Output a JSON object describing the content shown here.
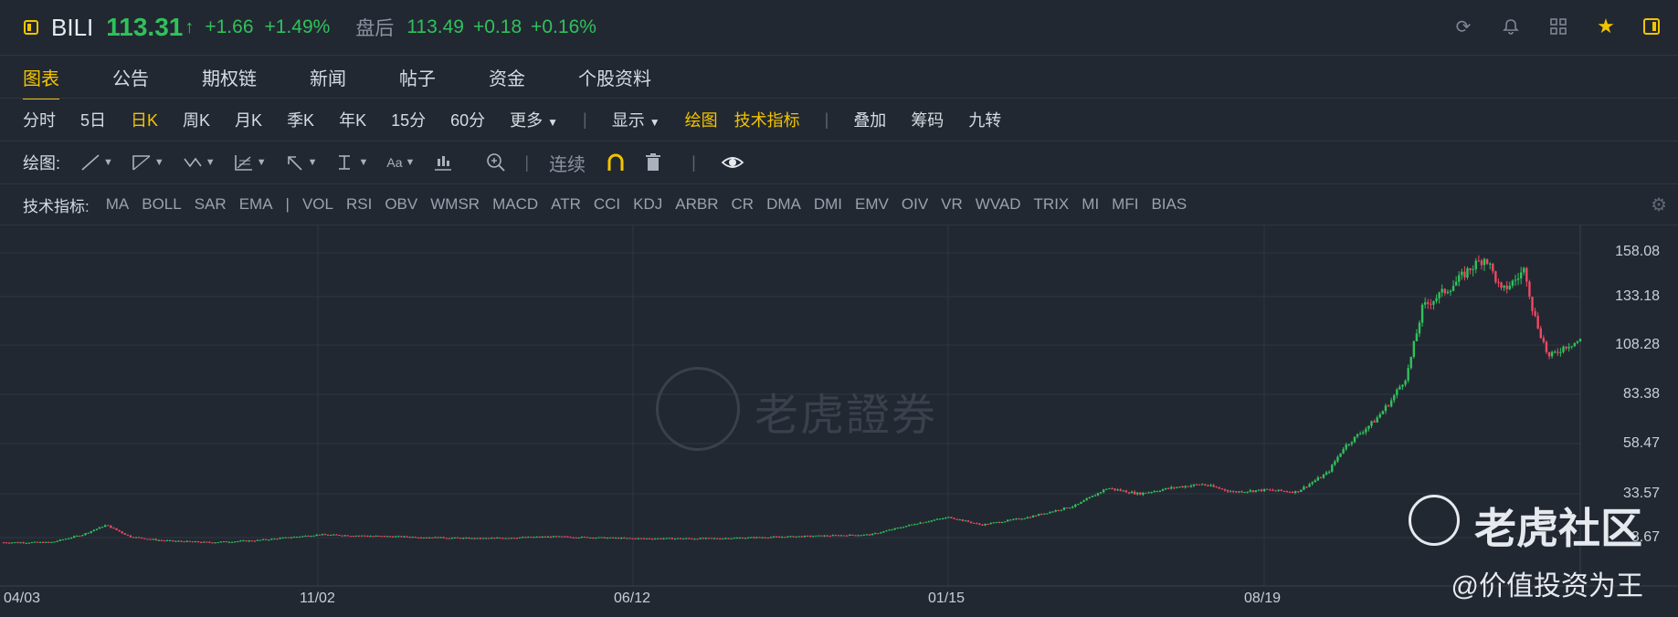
{
  "header": {
    "ticker": "BILI",
    "price": "113.31",
    "arrow": "↑",
    "change": "+1.66",
    "change_pct": "+1.49%",
    "after_hours_label": "盘后",
    "after_hours_price": "113.49",
    "after_hours_change": "+0.18",
    "after_hours_change_pct": "+0.16%"
  },
  "tabs": [
    {
      "label": "图表",
      "active": true
    },
    {
      "label": "公告"
    },
    {
      "label": "期权链"
    },
    {
      "label": "新闻"
    },
    {
      "label": "帖子"
    },
    {
      "label": "资金"
    },
    {
      "label": "个股资料"
    }
  ],
  "periods": {
    "items": [
      "分时",
      "5日",
      "日K",
      "周K",
      "月K",
      "季K",
      "年K",
      "15分",
      "60分",
      "更多"
    ],
    "active": "日K",
    "display_label": "显示",
    "draw_label": "绘图",
    "indicator_label": "技术指标",
    "overlay_label": "叠加",
    "chips_label": "筹码",
    "nine_turn_label": "九转"
  },
  "draw_tools": {
    "label": "绘图:",
    "continuous_label": "连续"
  },
  "indicators": {
    "label": "技术指标:",
    "main": [
      "MA",
      "BOLL",
      "SAR",
      "EMA"
    ],
    "sub": [
      "VOL",
      "RSI",
      "OBV",
      "WMSR",
      "MACD",
      "ATR",
      "CCI",
      "KDJ",
      "ARBR",
      "CR",
      "DMA",
      "DMI",
      "EMV",
      "OIV",
      "VR",
      "WVAD",
      "TRIX",
      "MI",
      "MFI",
      "BIAS"
    ]
  },
  "chart_data": {
    "type": "line",
    "y_ticks": [
      "158.08",
      "133.18",
      "108.28",
      "83.38",
      "58.47",
      "33.57",
      "8.67"
    ],
    "x_ticks": [
      "04/03",
      "11/02",
      "06/12",
      "01/15",
      "08/19"
    ],
    "ylim": [
      8.67,
      158.08
    ],
    "x": [
      0,
      0.03,
      0.05,
      0.065,
      0.08,
      0.1,
      0.13,
      0.16,
      0.2,
      0.25,
      0.3,
      0.35,
      0.4,
      0.45,
      0.5,
      0.55,
      0.58,
      0.6,
      0.62,
      0.65,
      0.68,
      0.7,
      0.72,
      0.74,
      0.76,
      0.78,
      0.8,
      0.82,
      0.84,
      0.85,
      0.87,
      0.88,
      0.89,
      0.9,
      0.92,
      0.93,
      0.94,
      0.95,
      0.96,
      0.965,
      0.97,
      0.98,
      0.99,
      1.0
    ],
    "values": [
      9,
      9,
      13,
      18,
      12,
      10,
      9,
      10,
      13,
      12,
      11,
      12,
      11,
      11,
      12,
      13,
      19,
      22,
      18,
      22,
      28,
      37,
      34,
      37,
      39,
      35,
      36,
      35,
      45,
      58,
      72,
      82,
      95,
      130,
      142,
      150,
      156,
      138,
      145,
      150,
      128,
      104,
      110,
      113
    ],
    "color_up": "#2fc25b",
    "color_down": "#f04864",
    "grid": true
  },
  "watermark": {
    "text": "老虎證券"
  },
  "social": {
    "name": "老虎社区",
    "user": "@价值投资为王"
  }
}
